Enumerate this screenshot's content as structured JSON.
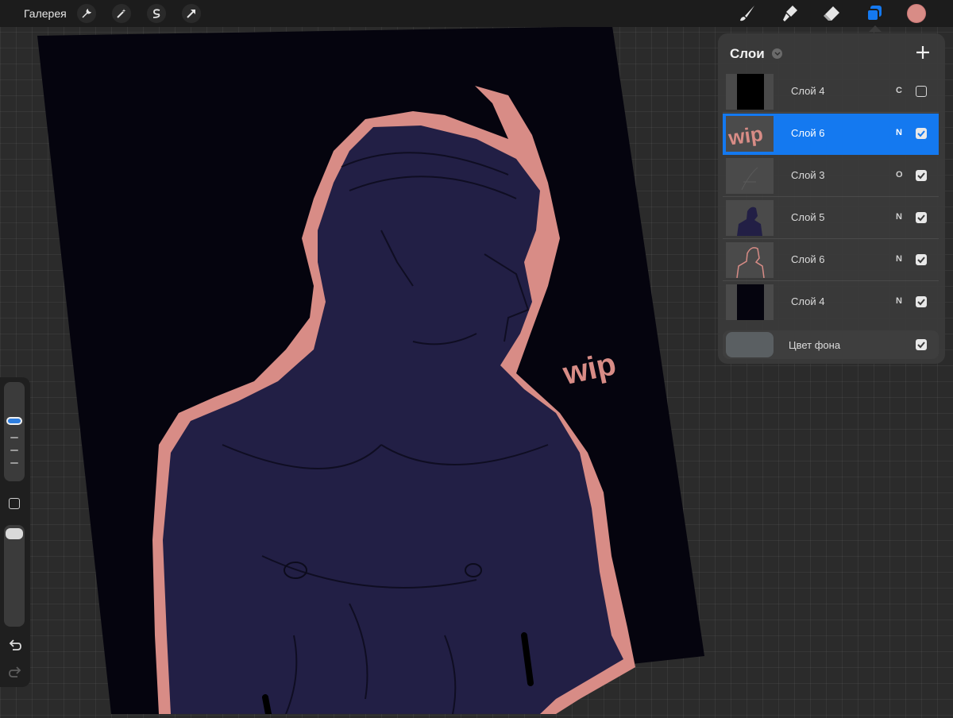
{
  "toolbar": {
    "gallery_label": "Галерея",
    "left_tools": [
      "wrench-icon",
      "magic-wand-icon",
      "selection-icon",
      "transform-arrow-icon"
    ],
    "right_tools": [
      "brush-icon",
      "smudge-icon",
      "eraser-icon",
      "layers-icon"
    ],
    "current_color": "#d88c86"
  },
  "layers_panel": {
    "title": "Слои",
    "layers": [
      {
        "name": "Слой 4",
        "blend": "C",
        "visible": false,
        "selected": false
      },
      {
        "name": "Слой 6",
        "blend": "N",
        "visible": true,
        "selected": true
      },
      {
        "name": "Слой 3",
        "blend": "O",
        "visible": true,
        "selected": false
      },
      {
        "name": "Слой 5",
        "blend": "N",
        "visible": true,
        "selected": false
      },
      {
        "name": "Слой 6",
        "blend": "N",
        "visible": true,
        "selected": false
      },
      {
        "name": "Слой 4",
        "blend": "N",
        "visible": true,
        "selected": false
      }
    ],
    "background": {
      "label": "Цвет фона",
      "visible": true,
      "color": "#5a5f62"
    }
  },
  "canvas": {
    "wip_text": "wip",
    "colors": {
      "paper": "#05040e",
      "figure": "#221f45",
      "outline": "#d88c86"
    }
  },
  "sidebar": {
    "icons": [
      "brush-size-slider",
      "modify-button",
      "opacity-slider",
      "undo-icon",
      "redo-icon"
    ]
  }
}
